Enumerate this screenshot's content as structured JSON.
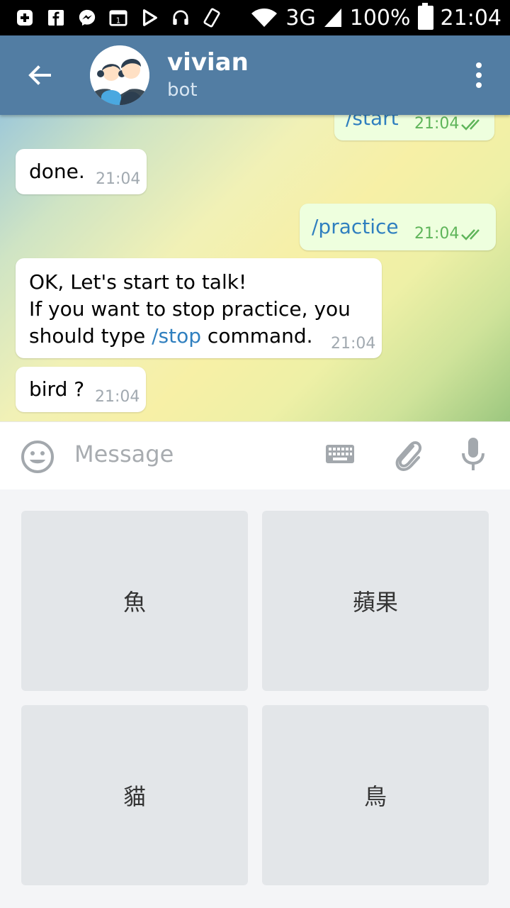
{
  "status_bar": {
    "network": "3G",
    "battery": "100%",
    "time": "21:04"
  },
  "header": {
    "title": "vivian",
    "subtitle": "bot"
  },
  "messages": [
    {
      "id": "m1",
      "direction": "out",
      "text": "/start",
      "time": "21:04"
    },
    {
      "id": "m2",
      "direction": "in",
      "text": "done.",
      "time": "21:04"
    },
    {
      "id": "m3",
      "direction": "out",
      "text": "/practice",
      "time": "21:04"
    },
    {
      "id": "m4",
      "direction": "in",
      "line1": "OK, Let's start to talk!",
      "line2": "If you want to stop practice, you",
      "line3_before": "should type ",
      "line3_cmd": "/stop",
      "line3_after": " command.",
      "time": "21:04"
    },
    {
      "id": "m5",
      "direction": "in",
      "text": "bird ?",
      "time": "21:04"
    }
  ],
  "input": {
    "placeholder": "Message"
  },
  "keyboard": {
    "keys": [
      "魚",
      "蘋果",
      "貓",
      "鳥"
    ]
  },
  "colors": {
    "header": "#527da3",
    "outgoing_bubble": "#eeffde",
    "link": "#2f7fbf",
    "key": "#e3e6e9"
  }
}
